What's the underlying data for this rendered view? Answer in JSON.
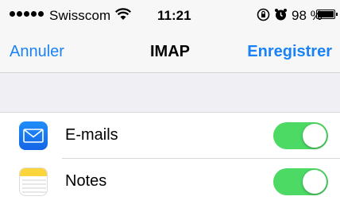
{
  "status_bar": {
    "carrier": "Swisscom",
    "time": "11:21",
    "battery_percent": "98 %",
    "battery_level": 0.98,
    "icons": [
      "signal-dots-icon",
      "wifi-icon",
      "rotation-lock-icon",
      "alarm-icon",
      "battery-icon"
    ]
  },
  "nav": {
    "cancel_label": "Annuler",
    "title": "IMAP",
    "save_label": "Enregistrer",
    "accent_color": "#1a82f5"
  },
  "rows": [
    {
      "label": "E-mails",
      "icon": "mail-icon",
      "toggle_on": true
    },
    {
      "label": "Notes",
      "icon": "notes-icon",
      "toggle_on": true
    }
  ],
  "colors": {
    "toggle_on": "#4cd964",
    "group_background": "#efeff4"
  }
}
